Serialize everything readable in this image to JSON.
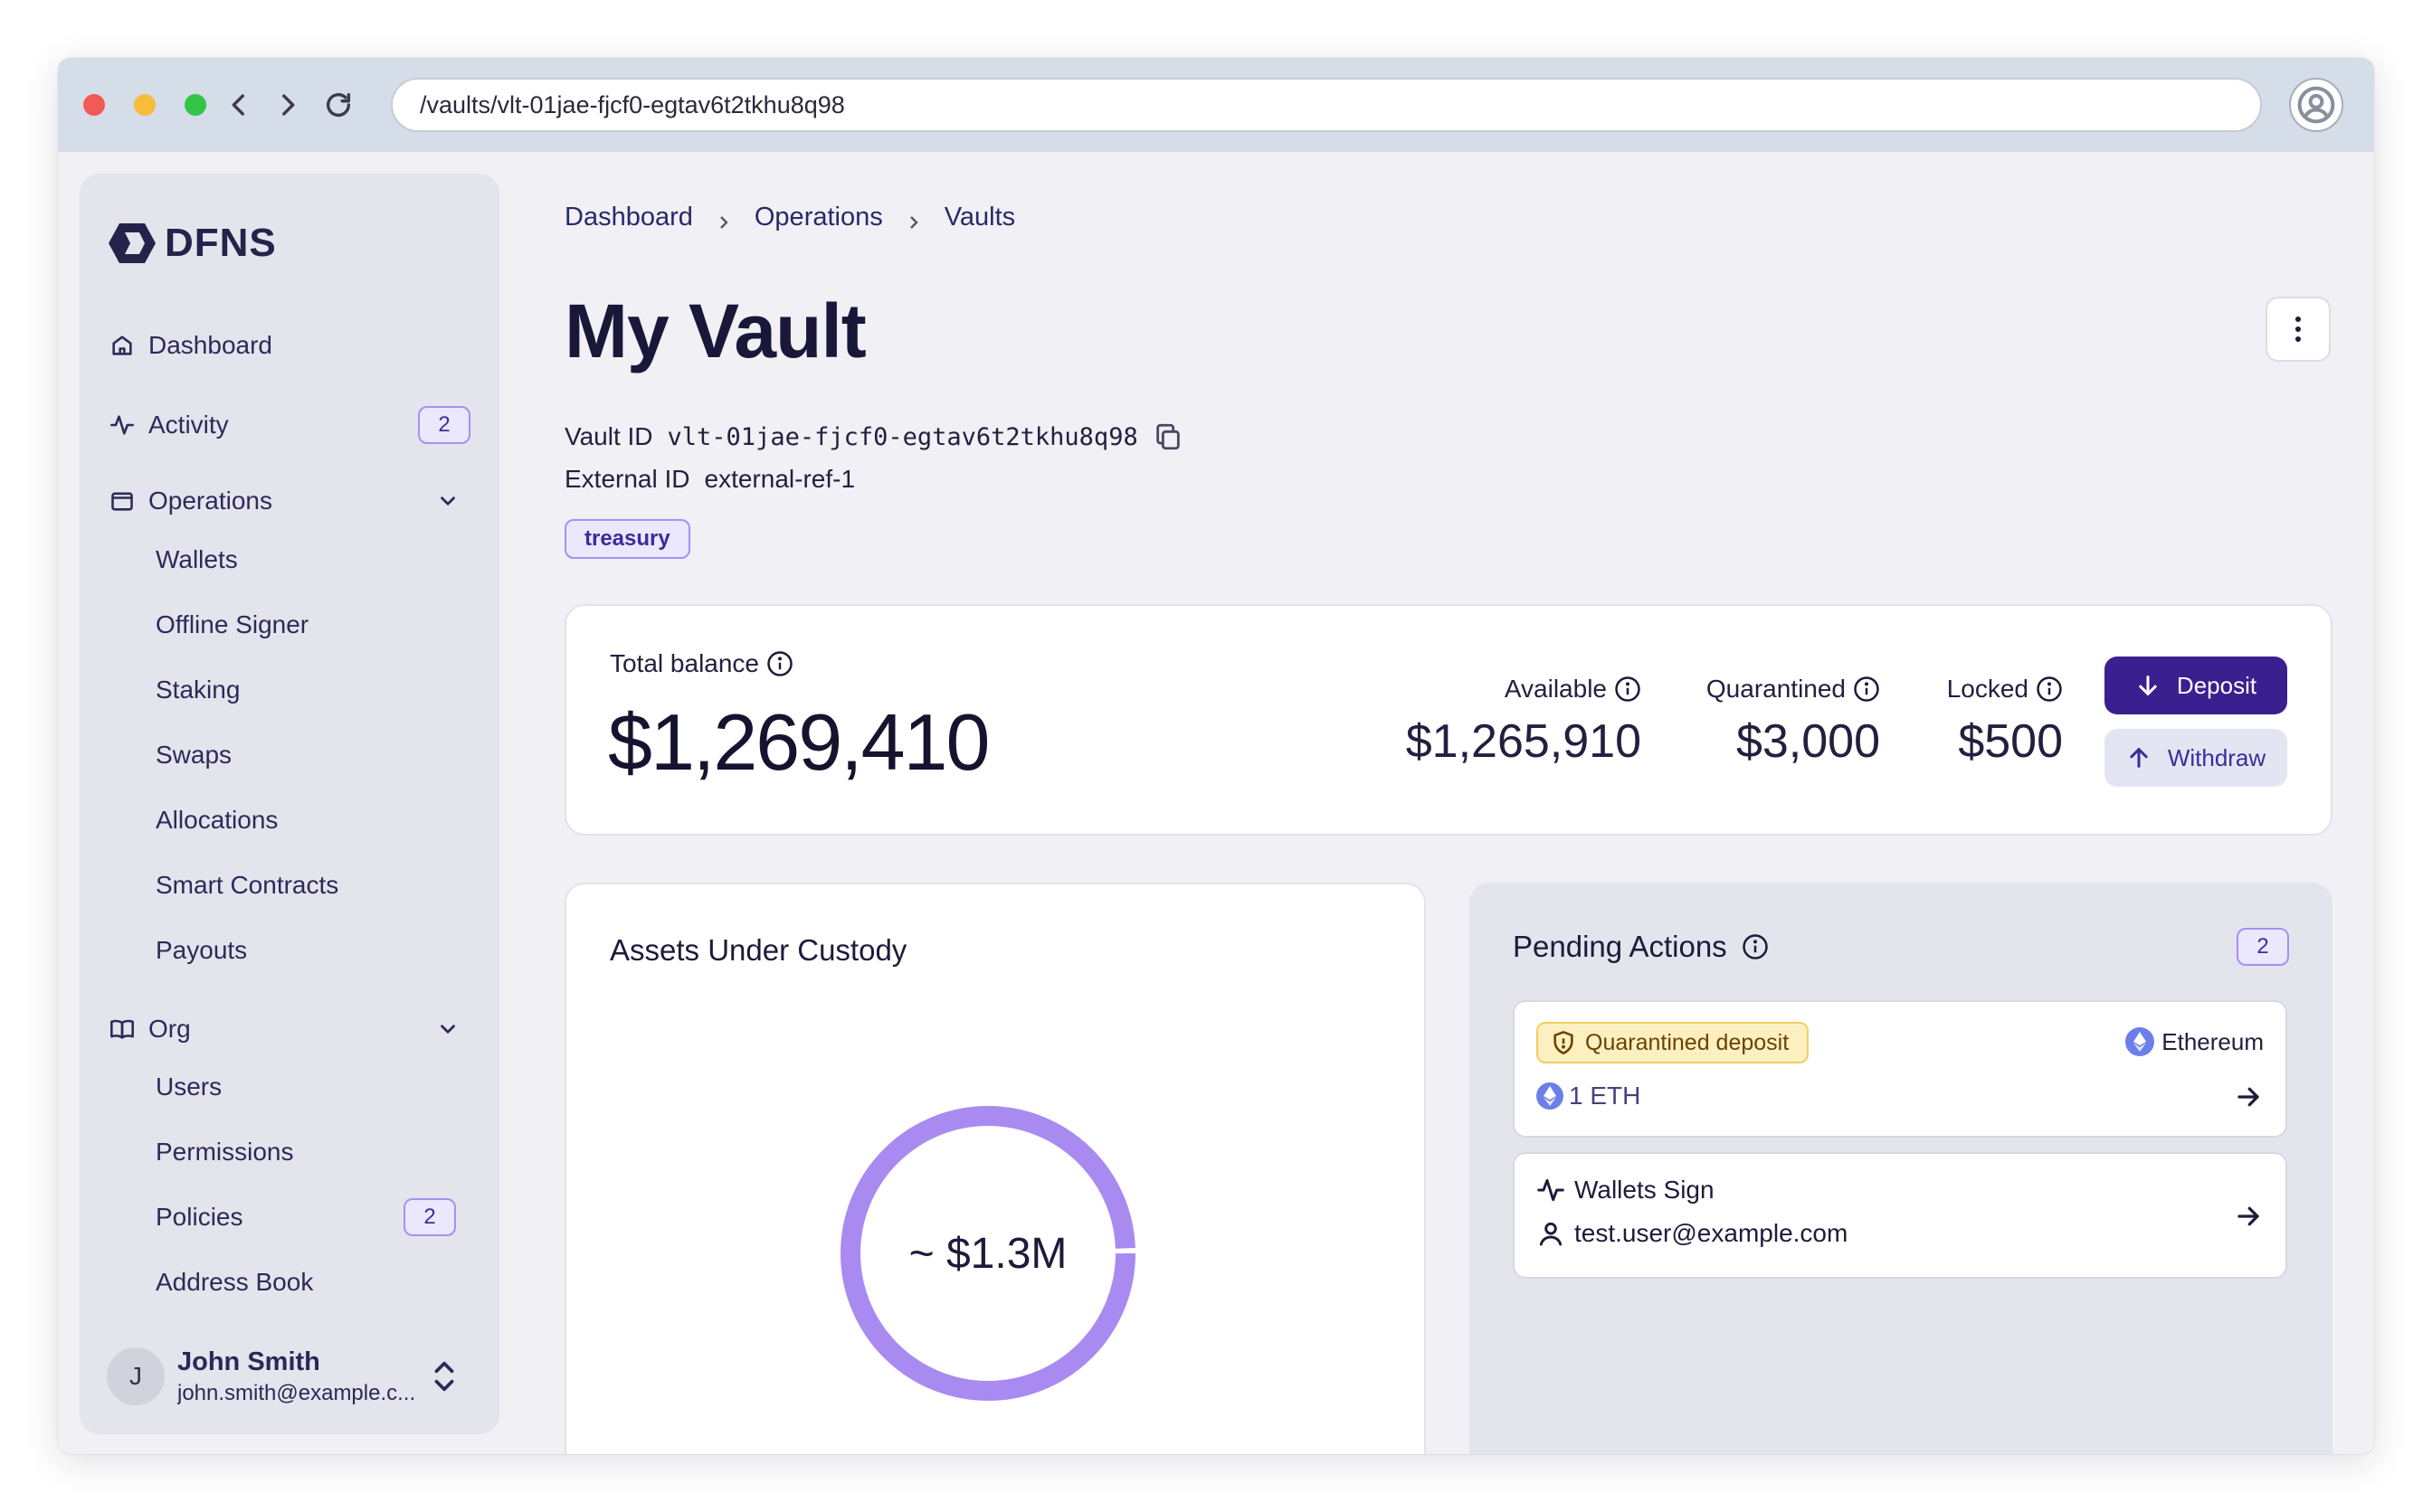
{
  "browser": {
    "url": "/vaults/vlt-01jae-fjcf0-egtav6t2tkhu8q98"
  },
  "sidebar": {
    "logo_text": "DFNS",
    "items": [
      {
        "label": "Dashboard"
      },
      {
        "label": "Activity",
        "badge": "2"
      },
      {
        "label": "Operations"
      },
      {
        "label": "Org"
      }
    ],
    "operations_sub": [
      {
        "label": "Wallets"
      },
      {
        "label": "Offline Signer"
      },
      {
        "label": "Staking"
      },
      {
        "label": "Swaps"
      },
      {
        "label": "Allocations"
      },
      {
        "label": "Smart Contracts"
      },
      {
        "label": "Payouts"
      }
    ],
    "org_sub": [
      {
        "label": "Users"
      },
      {
        "label": "Permissions"
      },
      {
        "label": "Policies",
        "badge": "2"
      },
      {
        "label": "Address Book"
      }
    ],
    "user": {
      "initial": "J",
      "name": "John Smith",
      "email": "john.smith@example.c..."
    }
  },
  "breadcrumb": [
    "Dashboard",
    "Operations",
    "Vaults"
  ],
  "page": {
    "title": "My Vault",
    "vault_id_label": "Vault ID",
    "vault_id": "vlt-01jae-fjcf0-egtav6t2tkhu8q98",
    "external_id_label": "External ID",
    "external_id": "external-ref-1",
    "tag": "treasury"
  },
  "balance": {
    "total_label": "Total balance",
    "total_value": "$1,269,410",
    "available_label": "Available",
    "available_value": "$1,265,910",
    "quarantined_label": "Quarantined",
    "quarantined_value": "$3,000",
    "locked_label": "Locked",
    "locked_value": "$500",
    "deposit_label": "Deposit",
    "withdraw_label": "Withdraw"
  },
  "auc": {
    "title": "Assets Under Custody",
    "center_label": "~ $1.3M"
  },
  "pending": {
    "title": "Pending Actions",
    "count": "2",
    "actions": [
      {
        "tag": "Quarantined deposit",
        "network": "Ethereum",
        "amount": "1 ETH"
      },
      {
        "title": "Wallets Sign",
        "user": "test.user@example.com"
      }
    ]
  },
  "colors": {
    "accent": "#3a1f8f",
    "donut": "#a98af0",
    "warning_bg": "#fdf0c0"
  }
}
